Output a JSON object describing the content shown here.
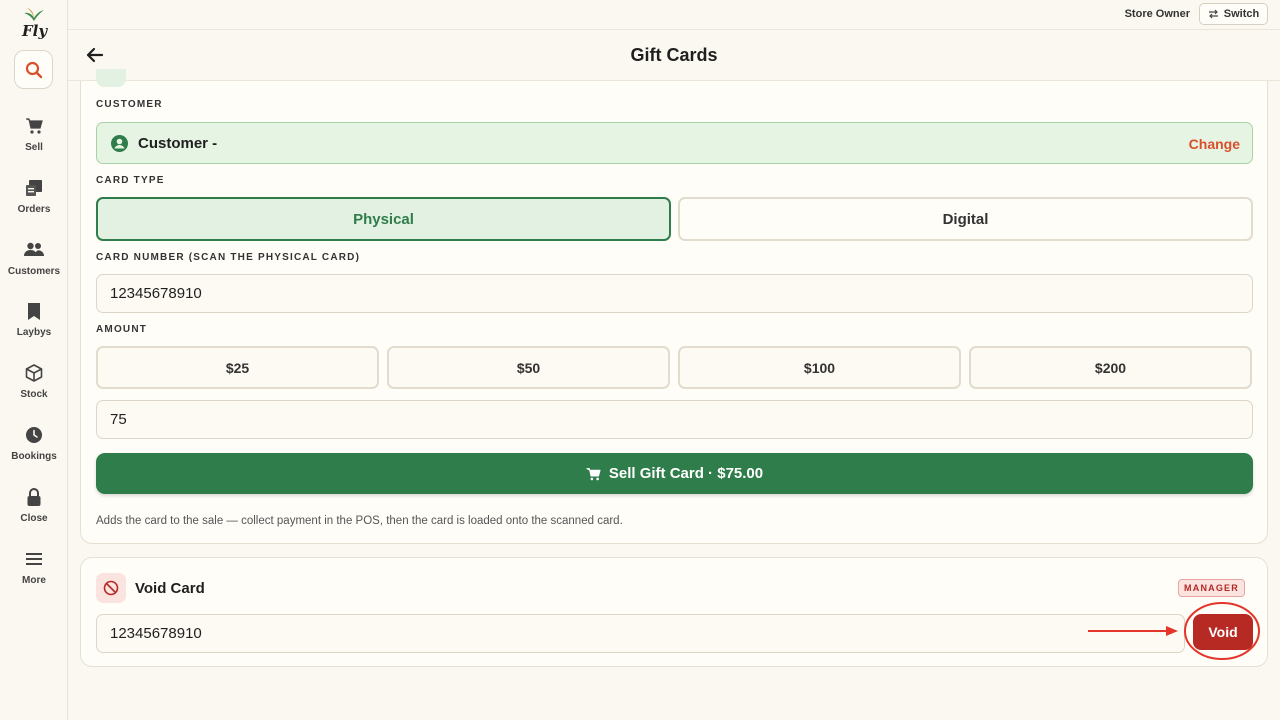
{
  "app": {
    "logo_text": "Fly"
  },
  "topbar": {
    "role": "Store Owner",
    "switch_label": "Switch"
  },
  "header": {
    "title": "Gift Cards"
  },
  "sidebar": {
    "items": [
      {
        "label": "Sell",
        "icon": "cart-icon"
      },
      {
        "label": "Orders",
        "icon": "receipt-icon"
      },
      {
        "label": "Customers",
        "icon": "users-icon"
      },
      {
        "label": "Laybys",
        "icon": "bookmark-icon"
      },
      {
        "label": "Stock",
        "icon": "box-icon"
      },
      {
        "label": "Bookings",
        "icon": "clock-icon"
      },
      {
        "label": "Close",
        "icon": "lock-icon"
      },
      {
        "label": "More",
        "icon": "menu-icon"
      }
    ]
  },
  "sell_card": {
    "customer_label": "CUSTOMER",
    "customer_name": "Customer -",
    "change_label": "Change",
    "card_type_label": "CARD TYPE",
    "card_types": [
      "Physical",
      "Digital"
    ],
    "selected_type": "Physical",
    "card_number_label": "CARD NUMBER (SCAN THE PHYSICAL CARD)",
    "card_number": "12345678910",
    "amount_label": "AMOUNT",
    "amount_presets": [
      "$25",
      "$50",
      "$100",
      "$200"
    ],
    "amount_value": "75",
    "sell_button_label": "Sell Gift Card · $75.00",
    "hint": "Adds the card to the sale — collect payment in the POS, then the card is loaded onto the scanned card."
  },
  "void_card": {
    "title": "Void Card",
    "badge": "MANAGER",
    "card_number": "12345678910",
    "void_button_label": "Void"
  },
  "colors": {
    "brand_green": "#2f7d4a",
    "accent_orange": "#d9502b",
    "danger_red": "#b72a24",
    "background": "#fbf8f1"
  }
}
